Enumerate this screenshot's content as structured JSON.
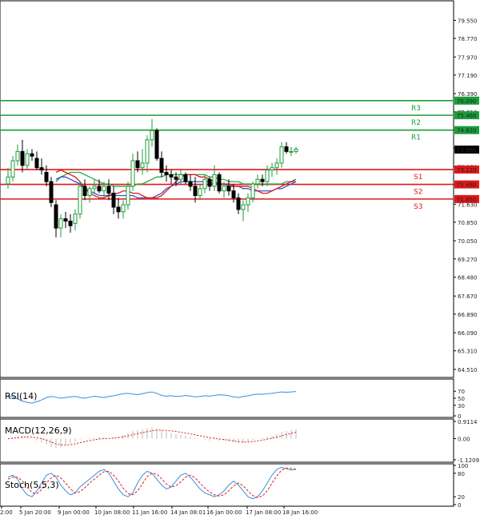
{
  "chart_data": {
    "type": "candlestick",
    "colors": {
      "bull": "#1a9e3a",
      "bear": "#000000",
      "resistance": "#1a9e3a",
      "support": "#e01818",
      "ma_fast": "#e01818",
      "ma_mid": "#3355cc",
      "ma_slow": "#2aa84a",
      "rsi": "#3b8fd8",
      "macd_signal": "#e01818",
      "stoch_k": "#3b8fd8",
      "stoch_d": "#e01818"
    },
    "price_axis": {
      "ylim": [
        64.3,
        80.15
      ],
      "ticks": [
        "79.550",
        "78.770",
        "77.970",
        "77.190",
        "76.390",
        "75.610",
        "74.830",
        "74.050",
        "73.250",
        "72.470",
        "71.630",
        "70.850",
        "70.050",
        "69.270",
        "68.480",
        "67.670",
        "66.890",
        "66.090",
        "65.310",
        "64.510"
      ]
    },
    "current_price": "73.980",
    "levels": [
      {
        "name": "R3",
        "value": 76.09,
        "label": "76.090",
        "kind": "resistance"
      },
      {
        "name": "R2",
        "value": 75.46,
        "label": "75.460",
        "kind": "resistance"
      },
      {
        "name": "R1",
        "value": 74.82,
        "label": "74.820",
        "kind": "resistance"
      },
      {
        "name": "S1",
        "value": 73.12,
        "label": "73.120",
        "kind": "support"
      },
      {
        "name": "S2",
        "value": 72.48,
        "label": "72.480",
        "kind": "support"
      },
      {
        "name": "S3",
        "value": 71.85,
        "label": "71.850",
        "kind": "support"
      }
    ],
    "x_labels": [
      "2:00",
      "5 Jan 20:00",
      "9 Jan 00:00",
      "10 Jan 08:00",
      "11 Jan 16:00",
      "14 Jan 08:01",
      "16 Jan 00:00",
      "17 Jan 08:00",
      "18 Jan 16:00"
    ],
    "candles": [
      [
        72.5,
        73.2,
        72.3,
        72.8
      ],
      [
        72.8,
        73.7,
        72.6,
        73.5
      ],
      [
        73.5,
        74.2,
        73.3,
        73.9
      ],
      [
        73.9,
        74.4,
        73.0,
        73.3
      ],
      [
        73.3,
        74.0,
        73.1,
        73.8
      ],
      [
        73.8,
        74.0,
        73.5,
        73.7
      ],
      [
        73.6,
        73.9,
        73.1,
        73.2
      ],
      [
        73.2,
        73.6,
        72.9,
        73.1
      ],
      [
        73.0,
        73.3,
        72.4,
        72.6
      ],
      [
        72.6,
        72.8,
        71.5,
        71.7
      ],
      [
        71.6,
        71.8,
        70.2,
        70.6
      ],
      [
        70.6,
        71.2,
        70.2,
        71.0
      ],
      [
        71.0,
        71.3,
        70.6,
        70.9
      ],
      [
        70.9,
        71.2,
        70.4,
        70.7
      ],
      [
        70.8,
        71.4,
        70.5,
        71.2
      ],
      [
        71.2,
        72.6,
        71.0,
        72.4
      ],
      [
        72.4,
        72.7,
        71.8,
        72.0
      ],
      [
        72.0,
        72.4,
        71.7,
        72.3
      ],
      [
        72.3,
        72.7,
        72.1,
        72.4
      ],
      [
        72.4,
        72.7,
        72.1,
        72.2
      ],
      [
        72.2,
        72.6,
        71.9,
        72.4
      ],
      [
        72.4,
        72.7,
        71.8,
        72.1
      ],
      [
        72.1,
        72.4,
        71.2,
        71.5
      ],
      [
        71.5,
        71.9,
        71.0,
        71.3
      ],
      [
        71.3,
        71.8,
        71.0,
        71.6
      ],
      [
        71.6,
        72.6,
        71.4,
        72.4
      ],
      [
        72.4,
        73.8,
        72.2,
        73.5
      ],
      [
        73.5,
        73.9,
        73.0,
        73.2
      ],
      [
        73.2,
        74.0,
        72.9,
        73.4
      ],
      [
        73.4,
        74.6,
        73.0,
        74.4
      ],
      [
        74.4,
        75.3,
        74.1,
        74.8
      ],
      [
        74.8,
        74.9,
        73.5,
        73.6
      ],
      [
        73.6,
        73.9,
        72.8,
        73.0
      ],
      [
        73.0,
        73.3,
        72.6,
        72.9
      ],
      [
        72.9,
        73.1,
        72.5,
        72.8
      ],
      [
        72.8,
        73.0,
        72.4,
        72.7
      ],
      [
        72.7,
        73.1,
        72.5,
        72.9
      ],
      [
        72.9,
        73.0,
        72.5,
        72.6
      ],
      [
        72.6,
        72.9,
        72.2,
        72.4
      ],
      [
        72.4,
        72.8,
        71.7,
        72.0
      ],
      [
        72.0,
        72.5,
        71.8,
        72.3
      ],
      [
        72.3,
        72.9,
        72.1,
        72.7
      ],
      [
        72.7,
        72.8,
        72.2,
        72.4
      ],
      [
        72.4,
        73.3,
        72.2,
        72.9
      ],
      [
        72.9,
        73.0,
        72.1,
        72.2
      ],
      [
        72.2,
        72.6,
        71.9,
        72.4
      ],
      [
        72.4,
        72.7,
        72.0,
        72.2
      ],
      [
        72.2,
        72.5,
        71.7,
        71.9
      ],
      [
        71.9,
        72.1,
        71.2,
        71.4
      ],
      [
        71.4,
        71.8,
        70.9,
        71.6
      ],
      [
        71.6,
        72.1,
        71.3,
        71.9
      ],
      [
        71.9,
        72.6,
        71.7,
        72.5
      ],
      [
        72.5,
        72.9,
        72.3,
        72.7
      ],
      [
        72.7,
        72.9,
        72.4,
        72.6
      ],
      [
        72.6,
        73.3,
        72.4,
        73.1
      ],
      [
        73.1,
        73.4,
        72.8,
        73.2
      ],
      [
        73.2,
        73.6,
        72.9,
        73.4
      ],
      [
        73.4,
        74.3,
        73.2,
        74.1
      ],
      [
        74.1,
        74.3,
        73.8,
        73.9
      ],
      [
        73.9,
        74.1,
        73.7,
        73.9
      ],
      [
        73.9,
        74.1,
        73.8,
        74.0
      ]
    ],
    "ma_fast": [
      73.0,
      73.1,
      73.0,
      72.9,
      72.8,
      72.6,
      72.3,
      72.1,
      72.0,
      71.9,
      71.9,
      72.0,
      72.1,
      72.1,
      72.2,
      72.2,
      72.1,
      72.1,
      72.0,
      71.9,
      71.9,
      71.9,
      72.0,
      72.2,
      72.4,
      72.6,
      72.8,
      72.9,
      72.9,
      72.9,
      72.8,
      72.8,
      72.7,
      72.6,
      72.5,
      72.5,
      72.5,
      72.4,
      72.4,
      72.4,
      72.4,
      72.3,
      72.2,
      72.1,
      72.1,
      72.2,
      72.3,
      72.4,
      72.5,
      72.6,
      72.7
    ],
    "ma_mid": [
      72.7,
      72.8,
      72.8,
      72.7,
      72.6,
      72.5,
      72.3,
      72.2,
      72.1,
      72.0,
      72.0,
      72.0,
      72.0,
      72.0,
      72.0,
      72.0,
      72.0,
      71.9,
      71.9,
      71.9,
      71.9,
      72.0,
      72.1,
      72.3,
      72.4,
      72.5,
      72.6,
      72.6,
      72.6,
      72.6,
      72.6,
      72.6,
      72.6,
      72.5,
      72.5,
      72.5,
      72.4,
      72.4,
      72.4,
      72.3,
      72.3,
      72.2,
      72.2,
      72.2,
      72.2,
      72.2,
      72.3,
      72.3,
      72.4,
      72.5,
      72.6
    ],
    "ma_slow": [
      72.6,
      72.8,
      72.9,
      73.0,
      73.0,
      73.0,
      72.9,
      72.8,
      72.7,
      72.6,
      72.5,
      72.5,
      72.4,
      72.4,
      72.4,
      72.4,
      72.4,
      72.5,
      72.5,
      72.6,
      72.7,
      72.8,
      72.8,
      72.9,
      72.9,
      72.9,
      72.9,
      72.9,
      72.9,
      72.9,
      72.9,
      72.9,
      72.8,
      72.8,
      72.7,
      72.7,
      72.6,
      72.6,
      72.6,
      72.5,
      72.5,
      72.5,
      72.5,
      72.5,
      72.5,
      72.5,
      72.5,
      72.5,
      72.6,
      72.6,
      72.6
    ],
    "rsi": {
      "label": "RSI(14)",
      "ticks": [
        "70",
        "50",
        "30",
        "0"
      ],
      "ylim": [
        0,
        100
      ],
      "values": [
        58,
        54,
        48,
        42,
        38,
        36,
        40,
        45,
        52,
        55,
        53,
        50,
        52,
        54,
        55,
        52,
        50,
        53,
        56,
        54,
        52,
        55,
        57,
        60,
        63,
        64,
        62,
        60,
        63,
        66,
        68,
        64,
        58,
        56,
        57,
        55,
        56,
        58,
        56,
        54,
        55,
        57,
        56,
        58,
        60,
        59,
        57,
        54,
        52,
        55,
        57,
        60,
        62,
        61,
        63,
        64,
        66,
        68,
        67,
        68,
        69
      ]
    },
    "macd": {
      "label": "MACD(12,26,9)",
      "ticks": [
        "0.9114",
        "0.00",
        "-1.1209"
      ],
      "ylim": [
        -1.1209,
        0.9114
      ],
      "histogram": [
        0.0,
        0.05,
        0.1,
        0.15,
        0.1,
        0.0,
        -0.1,
        -0.2,
        -0.3,
        -0.45,
        -0.5,
        -0.45,
        -0.35,
        -0.25,
        -0.15,
        -0.05,
        0.0,
        0.05,
        0.05,
        0.1,
        0.05,
        0.0,
        0.05,
        0.1,
        0.2,
        0.3,
        0.4,
        0.45,
        0.5,
        0.55,
        0.6,
        0.55,
        0.45,
        0.35,
        0.3,
        0.25,
        0.2,
        0.15,
        0.1,
        0.05,
        0.0,
        -0.05,
        -0.1,
        -0.05,
        -0.1,
        -0.1,
        -0.15,
        -0.2,
        -0.25,
        -0.2,
        -0.15,
        -0.1,
        0.0,
        0.05,
        0.1,
        0.15,
        0.25,
        0.35,
        0.4,
        0.45,
        0.5
      ],
      "signal": [
        0.0,
        0.02,
        0.05,
        0.08,
        0.1,
        0.08,
        0.05,
        0.0,
        -0.08,
        -0.18,
        -0.28,
        -0.33,
        -0.34,
        -0.32,
        -0.27,
        -0.21,
        -0.15,
        -0.1,
        -0.06,
        -0.02,
        0.0,
        0.01,
        0.03,
        0.06,
        0.1,
        0.15,
        0.21,
        0.27,
        0.32,
        0.37,
        0.42,
        0.45,
        0.45,
        0.43,
        0.41,
        0.38,
        0.34,
        0.3,
        0.25,
        0.2,
        0.15,
        0.1,
        0.05,
        0.02,
        -0.02,
        -0.05,
        -0.08,
        -0.12,
        -0.16,
        -0.18,
        -0.18,
        -0.16,
        -0.12,
        -0.08,
        -0.03,
        0.02,
        0.08,
        0.15,
        0.22,
        0.28,
        0.34
      ]
    },
    "stoch": {
      "label": "Stoch(5,5,3)",
      "ticks": [
        "100",
        "80",
        "20",
        "0"
      ],
      "ylim": [
        0,
        100
      ],
      "k": [
        70,
        75,
        65,
        40,
        25,
        20,
        35,
        55,
        75,
        80,
        70,
        50,
        35,
        25,
        30,
        45,
        55,
        65,
        75,
        85,
        90,
        80,
        60,
        40,
        25,
        20,
        30,
        55,
        75,
        85,
        80,
        65,
        50,
        40,
        45,
        60,
        75,
        80,
        70,
        55,
        40,
        30,
        25,
        20,
        25,
        35,
        50,
        60,
        50,
        35,
        20,
        15,
        20,
        35,
        55,
        75,
        90,
        95,
        92,
        88,
        90
      ],
      "d": [
        65,
        70,
        70,
        60,
        45,
        30,
        28,
        38,
        55,
        68,
        75,
        68,
        55,
        40,
        30,
        33,
        43,
        55,
        65,
        75,
        84,
        85,
        75,
        60,
        42,
        28,
        25,
        35,
        53,
        72,
        80,
        78,
        66,
        52,
        45,
        48,
        58,
        70,
        75,
        68,
        55,
        42,
        32,
        25,
        22,
        25,
        35,
        48,
        55,
        48,
        35,
        23,
        18,
        22,
        35,
        55,
        73,
        88,
        93,
        92,
        90
      ]
    }
  }
}
